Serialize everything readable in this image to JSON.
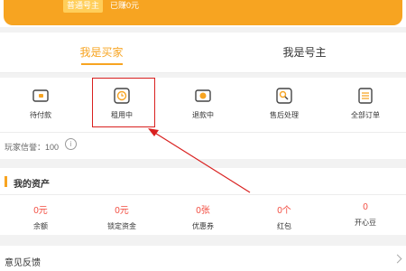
{
  "header": {
    "level_badge": "普通号主",
    "earned_text": "已赚0元"
  },
  "tabs": [
    {
      "label": "我是买家",
      "active": true
    },
    {
      "label": "我是号主",
      "active": false
    }
  ],
  "orders": [
    {
      "label": "待付款",
      "icon": "wallet-icon"
    },
    {
      "label": "租用中",
      "icon": "clock-icon"
    },
    {
      "label": "退款中",
      "icon": "refund-icon"
    },
    {
      "label": "售后处理",
      "icon": "service-icon"
    },
    {
      "label": "全部订单",
      "icon": "list-icon"
    }
  ],
  "credit": {
    "text": "玩家信誉：100",
    "info_icon": "i"
  },
  "assets": {
    "title": "我的资产",
    "items": [
      {
        "value": "0元",
        "label": "余额"
      },
      {
        "value": "0元",
        "label": "锁定资金"
      },
      {
        "value": "0张",
        "label": "优惠券"
      },
      {
        "value": "0个",
        "label": "红包"
      },
      {
        "value": "0",
        "label": "开心豆"
      }
    ]
  },
  "feedback": {
    "label": "意见反馈"
  },
  "colors": {
    "accent": "#f7a421",
    "value_red": "#f24b3f",
    "annotation_red": "#d9201f"
  }
}
